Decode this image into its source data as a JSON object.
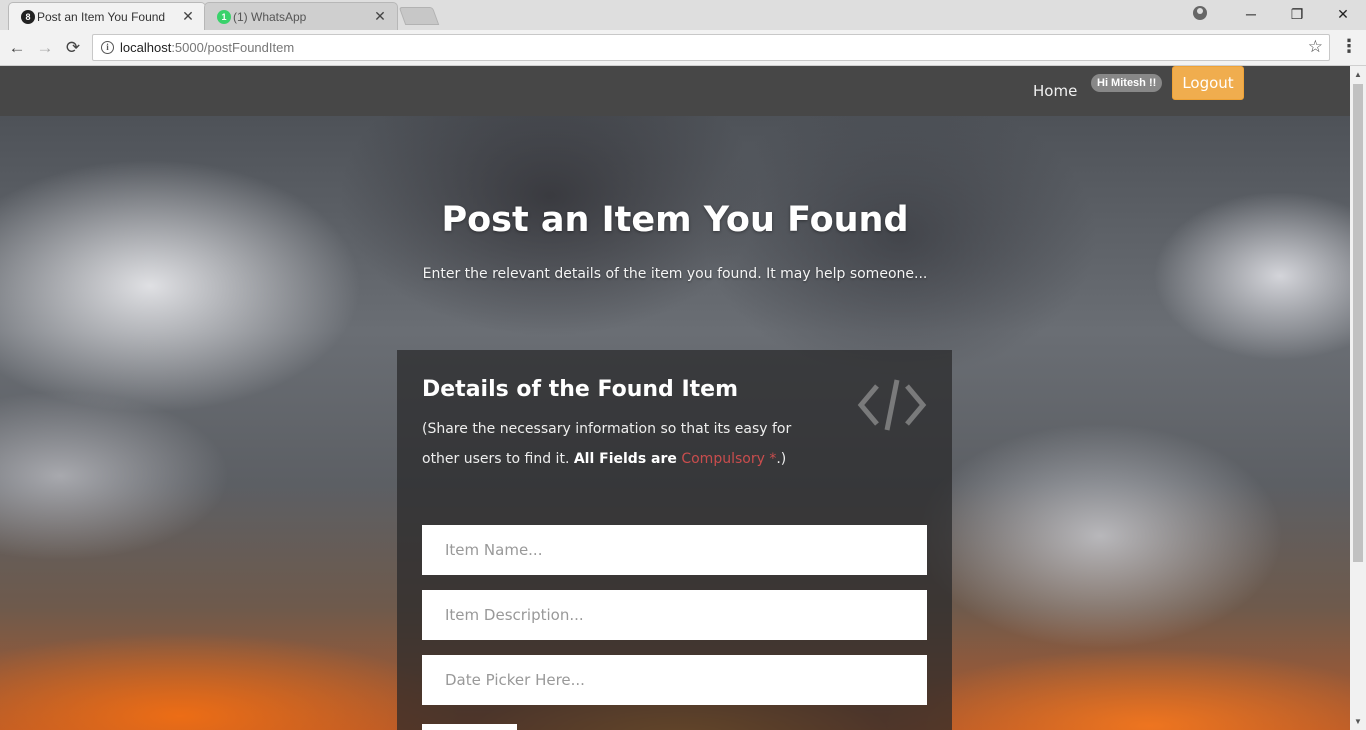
{
  "browser": {
    "tabs": [
      {
        "title": "Post an Item You Found",
        "favicon": "8",
        "active": true
      },
      {
        "title": "(1) WhatsApp",
        "favicon": "1",
        "active": false
      }
    ],
    "close_glyph": "✕",
    "url_host": "localhost",
    "url_path": ":5000/postFoundItem",
    "info_glyph": "i",
    "back_glyph": "←",
    "forward_glyph": "→",
    "reload_glyph": "⟳",
    "star_glyph": "☆",
    "menu_glyph": "⋮",
    "window_controls": {
      "minimize": "─",
      "maximize": "❐",
      "close": "✕"
    }
  },
  "navbar": {
    "home_label": "Home",
    "greeting": "Hi Mitesh !!",
    "logout_label": "Logout"
  },
  "hero": {
    "title": "Post an Item You Found",
    "subtitle": "Enter the relevant details of the item you found. It may help someone..."
  },
  "form": {
    "heading": "Details of the Found Item",
    "note_prefix": "(Share the necessary information so that its easy for other users to find it.",
    "note_bold": "All Fields are",
    "note_required": "Compulsory *",
    "note_suffix": ".)",
    "fields": {
      "item_name_placeholder": "Item Name...",
      "item_description_placeholder": "Item Description...",
      "date_placeholder": "Date Picker Here..."
    }
  },
  "colors": {
    "navbar_bg": "#474747",
    "logout_bg": "#f0ad4e",
    "required_text": "#c94d4d",
    "panel_bg": "rgba(40,40,42,0.72)"
  },
  "icons": {
    "code_icon": "code-icon",
    "info_icon": "info-icon",
    "star_icon": "star-icon"
  }
}
